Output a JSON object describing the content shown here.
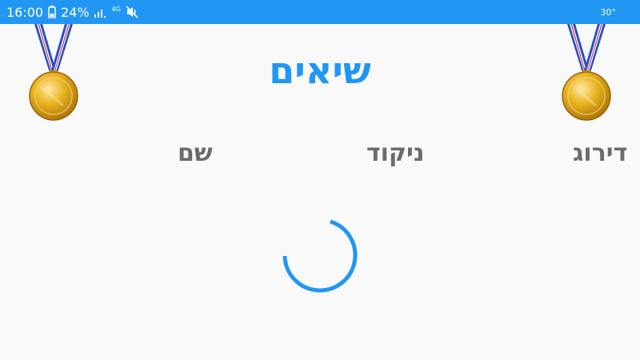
{
  "status_bar": {
    "time": "16:00",
    "battery_percent": "24%",
    "network_type": "4G",
    "temperature": "30°",
    "icons": [
      "battery-icon",
      "signal-icon",
      "network-4g-icon",
      "mute-icon"
    ],
    "background_color": "#2196f3"
  },
  "leaderboard": {
    "title": "שיאים",
    "columns": {
      "rank": "דירוג",
      "score": "ניקוד",
      "name": "שם"
    },
    "title_color": "#2196f3",
    "header_color": "#6b6b6b"
  },
  "decorations": {
    "left_icon": "gold-medal-icon",
    "right_icon": "gold-medal-icon"
  },
  "loading": {
    "indicator": "loading-spinner-icon",
    "color": "#2196f3"
  }
}
